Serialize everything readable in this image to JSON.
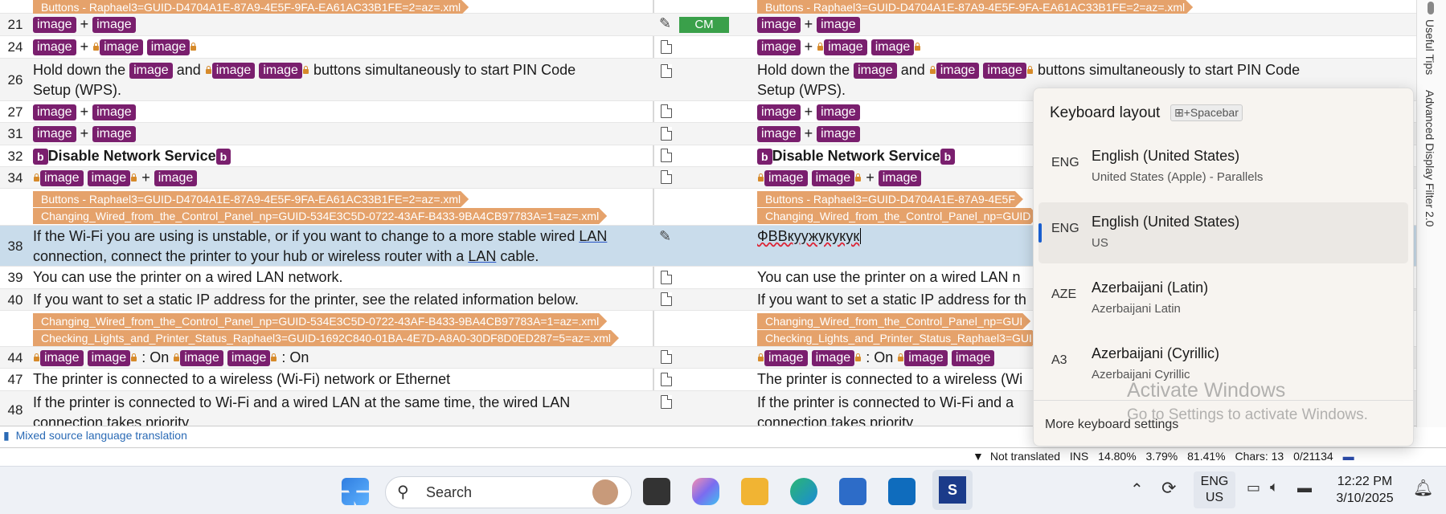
{
  "tags": {
    "image": "image",
    "b": "b",
    "plus": "+",
    "on": ": On"
  },
  "orange": {
    "buttons": "Buttons  -  Raphael3=GUID-D4704A1E-87A9-4E5F-9FA-EA61AC33B1FE=2=az=.xml",
    "buttons_full": "Buttons  -  Raphael3=GUID-D4704A1E-87A9-4E5F-9FA-EA61AC33B1FE=2=az=.xml",
    "changing": "Changing_Wired_from_the_Control_Panel_np=GUID-534E3C5D-0722-43AF-B433-9BA4CB97783A=1=az=.xml",
    "changing2": "Changing_Wired_from_the_Control_Panel_np=GUID-534E3C5D-0722-43AF-B433-9BA4CB97783A=1=az=.xml",
    "checking": "Checking_Lights_and_Printer_Status_Raphael3=GUID-1692C840-01BA-4E7D-A8A0-30DF8D0ED287=5=az=.xml",
    "tgt_buttons2": "Buttons  -  Raphael3=GUID-D4704A1E-87A9-4E5F",
    "tgt_changing": "Changing_Wired_from_the_Control_Panel_np=GUID",
    "tgt_changing2": "Changing_Wired_from_the_Control_Panel_np=GUI",
    "tgt_checking": "Checking_Lights_and_Printer_Status_Raphael3=GUI"
  },
  "rows": [
    {
      "num": "21"
    },
    {
      "num": "24"
    },
    {
      "num": "26",
      "before": "Hold down the",
      "and": "and",
      "after": "buttons simultaneously to start PIN Code",
      "line2": "Setup (WPS)."
    },
    {
      "num": "27"
    },
    {
      "num": "31"
    },
    {
      "num": "32",
      "text": "Disable Network Service"
    },
    {
      "num": "34"
    },
    {
      "num": "38",
      "src_a": "If the Wi-Fi you are using is unstable, or if you want to change to a more stable wired",
      "src_lan": "LAN",
      "src_b": "connection, connect the printer to your hub or wireless router with a",
      "src_lan2": "LAN",
      "src_c": "cable.",
      "tgt": "ФВВкуужукукук"
    },
    {
      "num": "39",
      "text": "You can use the printer on a wired LAN network.",
      "tgt": "You can use the printer on a wired LAN n"
    },
    {
      "num": "40",
      "text": "If you want to set a static IP address for the printer, see the related information below.",
      "tgt": "If you want to set a static IP address for th"
    },
    {
      "num": "44"
    },
    {
      "num": "47",
      "text": "The printer is connected to a wireless (Wi-Fi) network or Ethernet",
      "tgt": "The printer is connected to a wireless (Wi"
    },
    {
      "num": "48",
      "text": "If the printer is connected to Wi-Fi and a wired LAN at the same time, the wired LAN",
      "line2": "connection takes priority.",
      "tgt": "If the printer is connected to Wi-Fi and a",
      "tgt2": "connection takes priority."
    }
  ],
  "status": {
    "cm": "CM"
  },
  "sidebar": {
    "tips": "Useful Tips",
    "adv": "Advanced Display Filter 2.0"
  },
  "infobar": {
    "text": "Mixed source language translation"
  },
  "statusbar": {
    "not_translated": "Not translated",
    "ins": "INS",
    "p1": "14.80%",
    "p2": "3.79%",
    "p3": "81.41%",
    "chars": "Chars: 13",
    "count": "0/21134"
  },
  "keyboard": {
    "title": "Keyboard layout",
    "shortcut": "Spacebar",
    "plus": "+",
    "items": [
      {
        "code": "ENG",
        "name": "English (United States)",
        "sub": "United States (Apple) - Parallels"
      },
      {
        "code": "ENG",
        "name": "English (United States)",
        "sub": "US"
      },
      {
        "code": "AZE",
        "name": "Azerbaijani (Latin)",
        "sub": "Azerbaijani Latin"
      },
      {
        "code": "A3",
        "name": "Azerbaijani (Cyrillic)",
        "sub": "Azerbaijani Cyrillic"
      }
    ],
    "more": "More keyboard settings"
  },
  "watermark": {
    "line1": "Activate Windows",
    "line2": "Go to Settings to activate Windows."
  },
  "taskbar": {
    "search": "Search",
    "lang1": "ENG",
    "lang2": "US",
    "time": "12:22 PM",
    "date": "3/10/2025"
  },
  "colors": {
    "tag": "#7a1f6e",
    "orange": "#e5a26b",
    "selected_row": "#c9dceb",
    "cm": "#3aa04a"
  }
}
